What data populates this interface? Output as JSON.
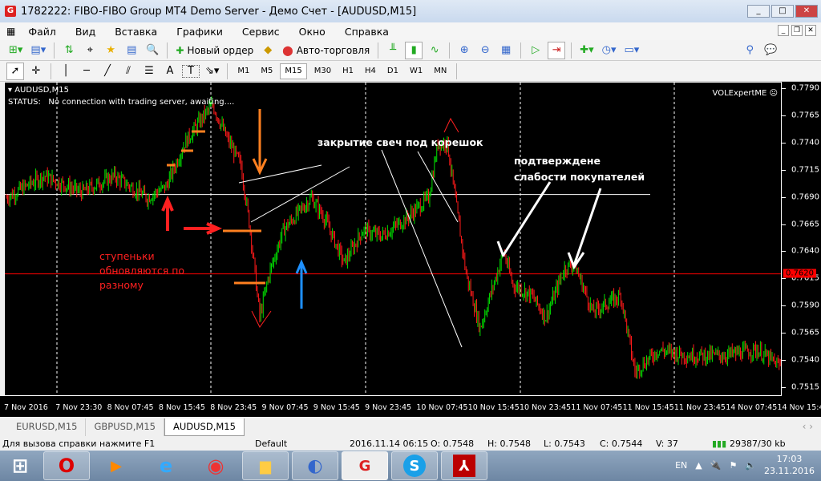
{
  "window": {
    "title": "1782222: FIBO-FIBO Group MT4 Demo Server - Демо Счет - [AUDUSD,M15]",
    "logo": "G"
  },
  "menu": [
    "Файл",
    "Вид",
    "Вставка",
    "Графики",
    "Сервис",
    "Окно",
    "Справка"
  ],
  "toolbar": {
    "new_order": "Новый ордер",
    "auto_trading": "Авто-торговля"
  },
  "drawing_tools": [
    "A",
    "T"
  ],
  "timeframes": [
    "M1",
    "M5",
    "M15",
    "M30",
    "H1",
    "H4",
    "D1",
    "W1",
    "MN"
  ],
  "active_timeframe": "M15",
  "chart": {
    "symbol": "AUDUSD,M15",
    "status": "STATUS:   No connection with trading server, awaiting....",
    "indicator": "VOLExpertME",
    "price_labels": [
      "0.7790",
      "0.7765",
      "0.7740",
      "0.7715",
      "0.7690",
      "0.7665",
      "0.7640",
      "0.7615",
      "0.7590",
      "0.7565",
      "0.7540",
      "0.7515"
    ],
    "current_price": "0.7620",
    "level_price": 0.7693,
    "time_labels": [
      "7 Nov 2016",
      "7 Nov 23:30",
      "8 Nov 07:45",
      "8 Nov 15:45",
      "8 Nov 23:45",
      "9 Nov 07:45",
      "9 Nov 15:45",
      "9 Nov 23:45",
      "10 Nov 07:45",
      "10 Nov 15:45",
      "10 Nov 23:45",
      "11 Nov 07:45",
      "11 Nov 15:45",
      "11 Nov 23:45",
      "14 Nov 07:45",
      "14 Nov 15:45"
    ],
    "price_path": [
      [
        0,
        0.769
      ],
      [
        8,
        0.771
      ],
      [
        16,
        0.7695
      ],
      [
        23,
        0.771
      ],
      [
        30,
        0.769
      ],
      [
        34,
        0.77
      ],
      [
        38,
        0.774
      ],
      [
        42,
        0.7765
      ],
      [
        44,
        0.7775
      ],
      [
        47,
        0.7745
      ],
      [
        50,
        0.772
      ],
      [
        52,
        0.766
      ],
      [
        54,
        0.758
      ],
      [
        56,
        0.762
      ],
      [
        59,
        0.766
      ],
      [
        65,
        0.769
      ],
      [
        68,
        0.767
      ],
      [
        72,
        0.763
      ],
      [
        76,
        0.766
      ],
      [
        80,
        0.7655
      ],
      [
        85,
        0.767
      ],
      [
        90,
        0.769
      ],
      [
        92,
        0.774
      ],
      [
        94,
        0.774
      ],
      [
        96,
        0.768
      ],
      [
        98,
        0.762
      ],
      [
        101,
        0.757
      ],
      [
        106,
        0.764
      ],
      [
        108,
        0.761
      ],
      [
        112,
        0.76
      ],
      [
        115,
        0.758
      ],
      [
        119,
        0.7625
      ],
      [
        121,
        0.763
      ],
      [
        125,
        0.7585
      ],
      [
        131,
        0.76
      ],
      [
        134,
        0.753
      ],
      [
        139,
        0.755
      ],
      [
        145,
        0.7545
      ],
      [
        153,
        0.7545
      ],
      [
        160,
        0.755
      ],
      [
        165,
        0.7535
      ]
    ],
    "annotations": {
      "steps": "ступеньки обновляются по разному",
      "closing": "закрытие свеч под корешок",
      "confirm": "подтверждене слабости покупателей"
    },
    "colors": {
      "bull": "#00e000",
      "bear": "#ff1a1a",
      "level": "#ff0000",
      "step": "#ff8020",
      "blue_arrow": "#1e90ff"
    }
  },
  "tabs": [
    {
      "label": "EURUSD,M15"
    },
    {
      "label": "GBPUSD,M15"
    },
    {
      "label": "AUDUSD,M15",
      "active": true
    }
  ],
  "statusbar": {
    "help": "Для вызова справки нажмите F1",
    "profile": "Default",
    "datetime": "2016.11.14 06:15",
    "open": "O: 0.7548",
    "high": "H: 0.7548",
    "low": "L: 0.7543",
    "close": "C: 0.7544",
    "volume": "V: 37",
    "traffic": "29387/30 kb"
  },
  "taskbar": {
    "apps": [
      "windows-start",
      "opera",
      "media-player",
      "internet-explorer",
      "chrome",
      "file-explorer",
      "metatrader-updater",
      "fibo-group",
      "skype",
      "acrobat-reader"
    ],
    "fibo_label": "G",
    "lang": "EN",
    "time": "17:03",
    "date": "23.11.2016"
  }
}
